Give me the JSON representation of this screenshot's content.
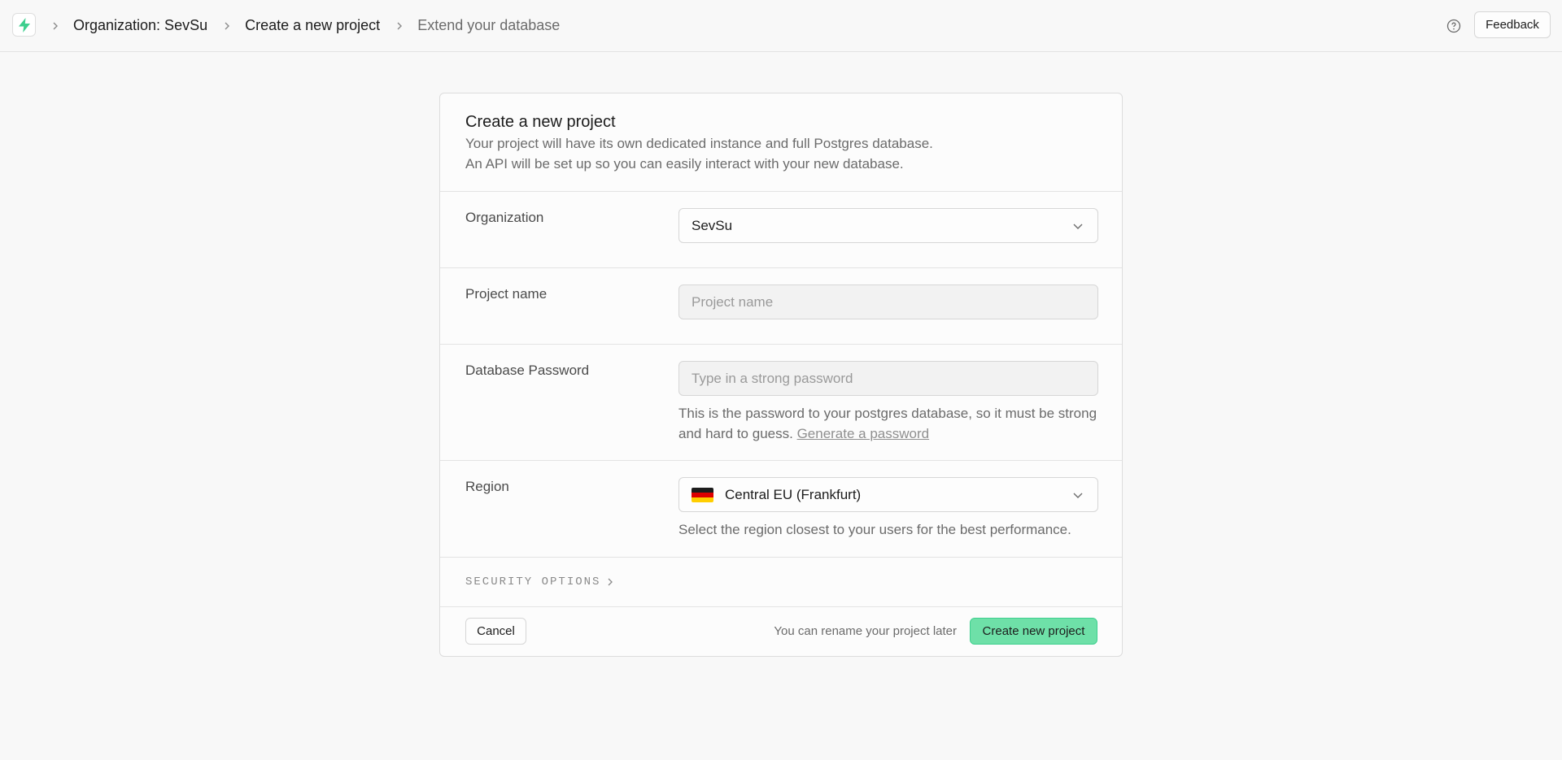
{
  "header": {
    "logo_icon": "supabase-bolt-icon",
    "breadcrumbs": [
      {
        "label": "Organization: SevSu"
      },
      {
        "label": "Create a new project"
      },
      {
        "label": "Extend your database"
      }
    ],
    "help_icon": "help-circle-icon",
    "feedback_label": "Feedback"
  },
  "card": {
    "title": "Create a new project",
    "description_line1": "Your project will have its own dedicated instance and full Postgres database.",
    "description_line2": "An API will be set up so you can easily interact with your new database."
  },
  "form": {
    "organization": {
      "label": "Organization",
      "value": "SevSu"
    },
    "project_name": {
      "label": "Project name",
      "value": "",
      "placeholder": "Project name"
    },
    "password": {
      "label": "Database Password",
      "value": "",
      "placeholder": "Type in a strong password",
      "hint": "This is the password to your postgres database, so it must be strong and hard to guess.",
      "generate_link": "Generate a password"
    },
    "region": {
      "label": "Region",
      "value": "Central EU (Frankfurt)",
      "flag_icon": "germany-flag-icon",
      "hint": "Select the region closest to your users for the best performance."
    },
    "security_options": "SECURITY OPTIONS"
  },
  "footer": {
    "cancel_label": "Cancel",
    "rename_note": "You can rename your project later",
    "create_label": "Create new project"
  },
  "colors": {
    "brand_green": "#3ecf8e",
    "create_button_bg": "#6ee0a8"
  }
}
